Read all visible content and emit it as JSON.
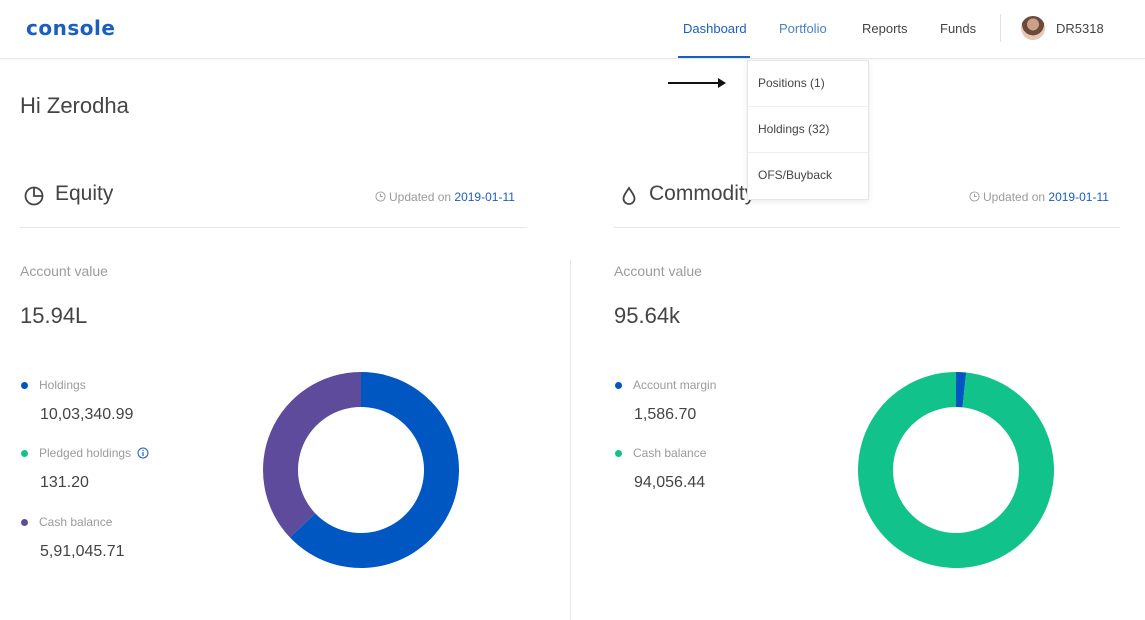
{
  "header": {
    "logo": "console",
    "nav": [
      {
        "label": "Dashboard"
      },
      {
        "label": "Portfolio"
      },
      {
        "label": "Reports"
      },
      {
        "label": "Funds"
      }
    ],
    "user_id": "DR5318",
    "accent": "#1a5ec1"
  },
  "portfolio_menu": {
    "items": [
      {
        "label": "Positions (1)"
      },
      {
        "label": "Holdings (32)"
      },
      {
        "label": "OFS/Buyback"
      }
    ]
  },
  "greeting": "Hi Zerodha",
  "equity": {
    "title": "Equity",
    "updated_prefix": "Updated on",
    "updated_date": "2019-01-11",
    "account_value_label": "Account value",
    "account_value": "15.94L",
    "legend": [
      {
        "label": "Holdings",
        "value": "10,03,340.99",
        "color": "#0057c2"
      },
      {
        "label": "Pledged holdings",
        "value": "131.20",
        "color": "#12c28b"
      },
      {
        "label": "Cash balance",
        "value": "5,91,045.71",
        "color": "#5f4b9b"
      }
    ]
  },
  "commodity": {
    "title": "Commodity",
    "updated_prefix": "Updated on",
    "updated_date": "2019-01-11",
    "account_value_label": "Account value",
    "account_value": "95.64k",
    "legend": [
      {
        "label": "Account margin",
        "value": "1,586.70",
        "color": "#0057c2"
      },
      {
        "label": "Cash balance",
        "value": "94,056.44",
        "color": "#12c28b"
      }
    ]
  },
  "chart_data": [
    {
      "type": "pie",
      "title": "",
      "categories": [
        "Holdings",
        "Pledged holdings",
        "Cash balance"
      ],
      "values": [
        1003340.99,
        131.2,
        591045.71
      ],
      "colors": [
        "#0057c2",
        "#12c28b",
        "#5f4b9b"
      ],
      "donut": true
    },
    {
      "type": "pie",
      "title": "",
      "categories": [
        "Account margin",
        "Cash balance"
      ],
      "values": [
        1586.7,
        94056.44
      ],
      "colors": [
        "#0057c2",
        "#12c28b"
      ],
      "donut": true
    }
  ]
}
